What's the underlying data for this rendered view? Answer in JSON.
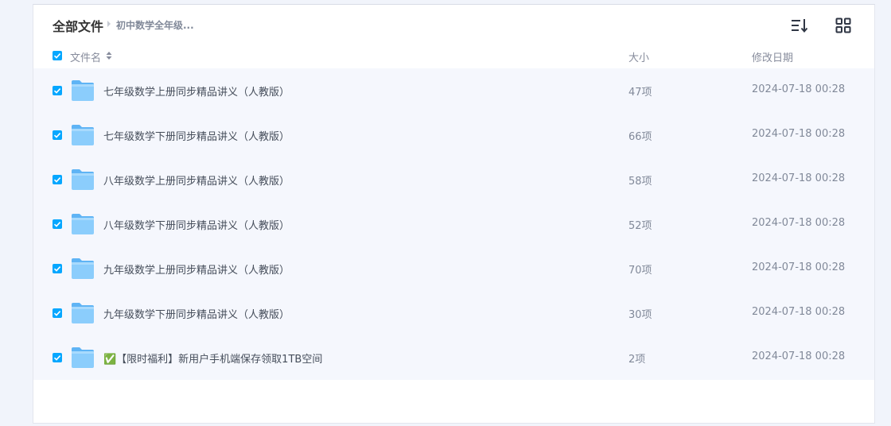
{
  "header": {
    "title": "全部文件",
    "breadcrumb": "初中数学全年级..."
  },
  "toolbar": {
    "sort_icon": "sort-lines-icon",
    "grid_icon": "grid-view-icon"
  },
  "columns": {
    "name": "文件名",
    "size": "大小",
    "date": "修改日期"
  },
  "colors": {
    "accent": "#06a7ff",
    "row_bg": "#f5f7fd",
    "folder": "#7cc6fb"
  },
  "files": [
    {
      "name": "七年级数学上册同步精品讲义（人教版）",
      "size": "47项",
      "date": "2024-07-18 00:28",
      "checked": true
    },
    {
      "name": "七年级数学下册同步精品讲义（人教版）",
      "size": "66项",
      "date": "2024-07-18 00:28",
      "checked": true
    },
    {
      "name": "八年级数学上册同步精品讲义（人教版）",
      "size": "58项",
      "date": "2024-07-18 00:28",
      "checked": true
    },
    {
      "name": "八年级数学下册同步精品讲义（人教版）",
      "size": "52项",
      "date": "2024-07-18 00:28",
      "checked": true
    },
    {
      "name": "九年级数学上册同步精品讲义（人教版）",
      "size": "70项",
      "date": "2024-07-18 00:28",
      "checked": true
    },
    {
      "name": "九年级数学下册同步精品讲义（人教版）",
      "size": "30项",
      "date": "2024-07-18 00:28",
      "checked": true
    },
    {
      "name": "✅【限时福利】新用户手机端保存领取1TB空间",
      "size": "2项",
      "date": "2024-07-18 00:28",
      "checked": true
    }
  ]
}
